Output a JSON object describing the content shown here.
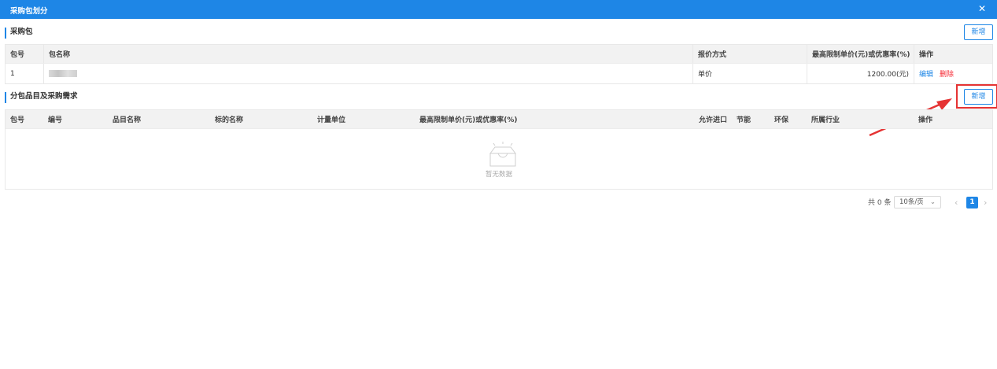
{
  "dialog": {
    "title": "采购包划分",
    "close_icon": "close-icon"
  },
  "section1": {
    "heading": "采购包",
    "add_label": "新增",
    "columns": [
      "包号",
      "包名称",
      "报价方式",
      "最高限制单价(元)或优惠率(%)",
      "操作"
    ],
    "rows": [
      {
        "no": "1",
        "name": "",
        "method": "单价",
        "price": "1200.00(元)",
        "edit": "编辑",
        "delete": "删除"
      }
    ]
  },
  "section2": {
    "heading": "分包品目及采购需求",
    "add_label": "新增",
    "columns": [
      "包号",
      "编号",
      "品目名称",
      "标的名称",
      "计量单位",
      "最高限制单价(元)或优惠率(%)",
      "允许进口",
      "节能",
      "环保",
      "所属行业",
      "操作"
    ],
    "empty_text": "暂无数据"
  },
  "pagination": {
    "total": "共 0 条",
    "page_size": "10条/页",
    "current_page": "1"
  },
  "colors": {
    "accent": "#1e86e6",
    "danger": "#f5222d",
    "highlight": "#e53333"
  }
}
